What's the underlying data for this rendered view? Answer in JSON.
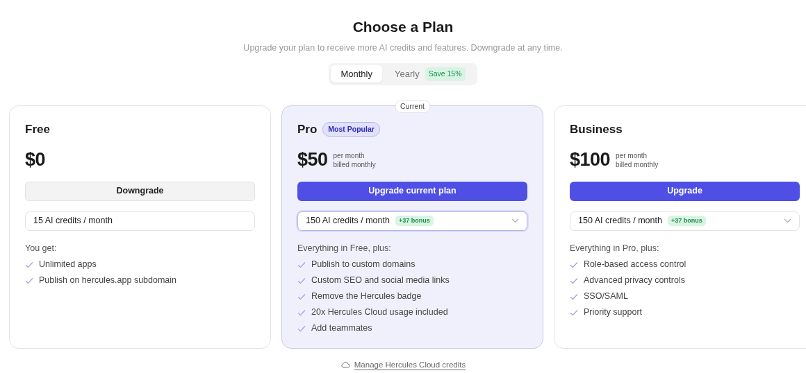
{
  "title": "Choose a Plan",
  "subtitle": "Upgrade your plan to receive more AI credits and features. Downgrade at any time.",
  "billing_toggle": [
    {
      "label": "Monthly",
      "selected": true
    },
    {
      "label": "Yearly",
      "selected": false,
      "badge": "Save 15%"
    }
  ],
  "plans": [
    {
      "name": "Free",
      "current": false,
      "price": "$0",
      "button": {
        "label": "Downgrade",
        "kind": "secondary"
      },
      "credits": {
        "kind": "static",
        "value": "15 AI credits / month",
        "focused": false
      },
      "features_heading": "You get:",
      "features": [
        "Unlimited apps",
        "Publish on hercules.app subdomain"
      ]
    },
    {
      "name": "Pro",
      "badge": "Most Popular",
      "current_label": "Current",
      "current": true,
      "price": "$50",
      "price_note": [
        "per month",
        "billed monthly"
      ],
      "button": {
        "label": "Upgrade current plan",
        "kind": "primary"
      },
      "credits": {
        "kind": "dropdown",
        "value": "150 AI credits / month",
        "bonus": "+37 bonus",
        "focused": true
      },
      "features_heading": "Everything in Free, plus:",
      "features": [
        "Publish to custom domains",
        "Custom SEO and social media links",
        "Remove the Hercules badge",
        "20x Hercules Cloud usage included",
        "Add teammates"
      ]
    },
    {
      "name": "Business",
      "current": false,
      "price": "$100",
      "price_note": [
        "per month",
        "billed monthly"
      ],
      "button": {
        "label": "Upgrade",
        "kind": "primary"
      },
      "credits": {
        "kind": "dropdown",
        "value": "150 AI credits / month",
        "bonus": "+37 bonus",
        "focused": false
      },
      "features_heading": "Everything in Pro, plus:",
      "features": [
        "Role-based access control",
        "Advanced privacy controls",
        "SSO/SAML",
        "Priority support"
      ]
    }
  ],
  "footer_link": "Manage Hercules Cloud credits"
}
